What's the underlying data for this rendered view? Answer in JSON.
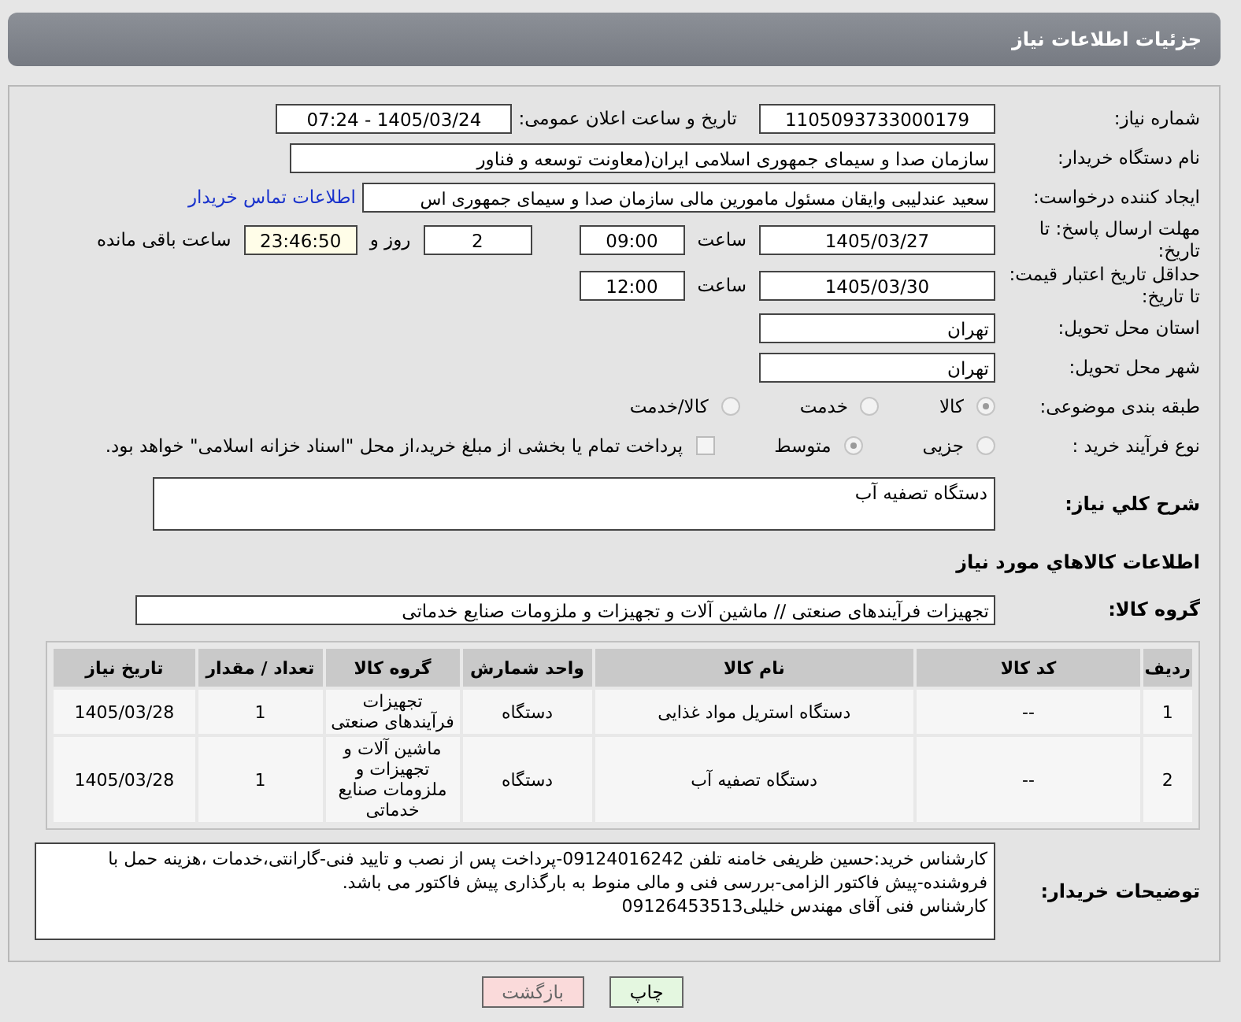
{
  "header": {
    "title": "جزئیات اطلاعات نیاز"
  },
  "need_number": {
    "label": "شماره نیاز:",
    "value": "1105093733000179"
  },
  "announce": {
    "label": "تاریخ و ساعت اعلان عمومی:",
    "value": "1405/03/24 - 07:24"
  },
  "buyer_org": {
    "label": "نام دستگاه خریدار:",
    "value": "سازمان صدا و سیمای جمهوری اسلامی ایران(معاونت توسعه و فناور"
  },
  "requester": {
    "label": "ایجاد کننده درخواست:",
    "value": "سعید عندلیبی وایقان مسئول مامورین مالی  سازمان صدا و سیمای جمهوری اس",
    "link": "اطلاعات تماس خریدار"
  },
  "response_deadline": {
    "label": "مهلت ارسال پاسخ: تا تاریخ:",
    "date": "1405/03/27",
    "time_label": "ساعت",
    "time": "09:00",
    "days": "2",
    "days_label": "روز و",
    "remaining": "23:46:50",
    "remaining_label": "ساعت باقی مانده"
  },
  "price_validity": {
    "label": "حداقل تاریخ اعتبار قیمت: تا تاریخ:",
    "date": "1405/03/30",
    "time_label": "ساعت",
    "time": "12:00"
  },
  "province": {
    "label": "استان محل تحویل:",
    "value": "تهران"
  },
  "city": {
    "label": "شهر محل تحویل:",
    "value": "تهران"
  },
  "category": {
    "label": "طبقه بندی موضوعی:",
    "options": [
      {
        "label": "کالا",
        "selected": true
      },
      {
        "label": "خدمت",
        "selected": false
      },
      {
        "label": "کالا/خدمت",
        "selected": false
      }
    ]
  },
  "purchase_process": {
    "label": "نوع فرآیند خرید :",
    "options": [
      {
        "label": "جزیی",
        "selected": false
      },
      {
        "label": "متوسط",
        "selected": true
      }
    ],
    "payment": {
      "label": "پرداخت تمام یا بخشی از مبلغ خرید،از محل \"اسناد خزانه اسلامی\" خواهد بود.",
      "checked": false
    }
  },
  "description": {
    "label": "شرح کلي نياز:",
    "value": "دستگاه تصفیه آب"
  },
  "goods_heading": "اطلاعات کالاهاي مورد نياز",
  "goods_group": {
    "label": "گروه کالا:",
    "value": "تجهیزات فرآیندهای صنعتی // ماشین آلات و تجهیزات و ملزومات صنایع خدماتی"
  },
  "table": {
    "columns": [
      "ردیف",
      "کد کالا",
      "نام کالا",
      "واحد شمارش",
      "گروه کالا",
      "تعداد / مقدار",
      "تاریخ نیاز"
    ],
    "rows": [
      [
        "1",
        "--",
        "دستگاه استریل مواد غذایی",
        "دستگاه",
        "تجهیزات فرآیندهای صنعتی",
        "1",
        "1405/03/28"
      ],
      [
        "2",
        "--",
        "دستگاه تصفیه آب",
        "دستگاه",
        "ماشین آلات و تجهیزات و ملزومات صنایع خدماتی",
        "1",
        "1405/03/28"
      ]
    ]
  },
  "buyer_notes": {
    "label": "توضیحات خریدار:",
    "lines": [
      "کارشناس خرید:حسین ظریفی خامنه تلفن 09124016242-پرداخت پس از نصب و تایید فنی-گارانتی،خدمات ،هزینه حمل با فروشنده-پیش فاکتور الزامی-بررسی فنی و مالی منوط به بارگذاری پیش فاکتور می باشد.",
      "کارشناس فنی آقای مهندس خلیلی09126453513"
    ]
  },
  "buttons": [
    {
      "label": "چاپ",
      "kind": "print"
    },
    {
      "label": "بازگشت",
      "kind": "back"
    }
  ]
}
